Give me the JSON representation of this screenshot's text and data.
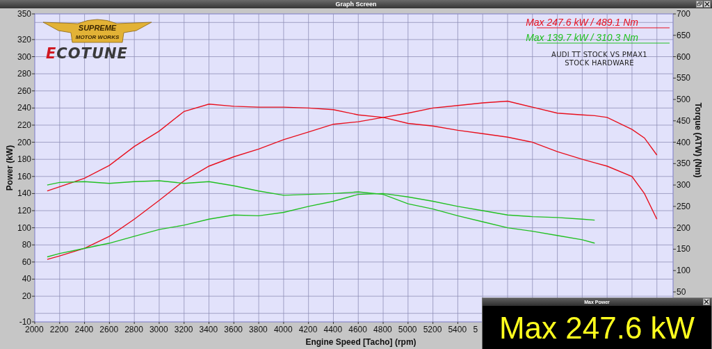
{
  "window": {
    "title": "Graph Screen"
  },
  "logos": {
    "badge_lines": [
      "SUPREME",
      "MOTOR WORKS"
    ],
    "wordmark": "ECOTUNE"
  },
  "legend": [
    {
      "text": "Max 247.6 kW  / 489.1 Nm",
      "color": "#e8101e"
    },
    {
      "text": "Max 139.7 kW  / 310.3 Nm",
      "color": "#22c022"
    }
  ],
  "caption": [
    "AUDI TT STOCK VS PMAX1",
    "STOCK HARDWARE"
  ],
  "chart_data": {
    "type": "line",
    "xlabel": "Engine Speed [Tacho] (rpm)",
    "ylabel": "Power (kW)",
    "y2label": "Torque (ATW) (Nm)",
    "x": [
      2100,
      2200,
      2400,
      2600,
      2800,
      3000,
      3200,
      3400,
      3600,
      3800,
      4000,
      4200,
      4400,
      4600,
      4800,
      5000,
      5200,
      5400,
      5600,
      5800,
      6000,
      6200,
      6400,
      6500,
      6600,
      6800,
      6900,
      7000
    ],
    "xlim": [
      2000,
      7130
    ],
    "ylim": [
      -10,
      350
    ],
    "y2lim": [
      -20,
      700
    ],
    "xticks": [
      2000,
      2200,
      2400,
      2600,
      2800,
      3000,
      3200,
      3400,
      3600,
      3800,
      4000,
      4200,
      4400,
      4600,
      4800,
      5000,
      5200,
      5400
    ],
    "grid": true,
    "yticks": [
      350,
      320,
      300,
      280,
      260,
      240,
      220,
      200,
      180,
      160,
      140,
      120,
      100,
      80,
      60,
      40,
      20,
      -10
    ],
    "y2ticks": [
      700,
      650,
      600,
      550,
      500,
      450,
      400,
      350,
      300,
      250,
      200,
      150,
      100,
      50
    ],
    "series": [
      {
        "color": "#e8101e",
        "values": [
          63,
          67,
          76,
          90,
          110,
          132,
          155,
          172,
          183,
          192,
          203,
          212,
          221,
          224,
          229,
          234,
          240,
          243,
          246,
          248,
          241,
          234,
          232,
          231,
          229,
          215,
          205,
          185
        ]
      },
      {
        "color": "#e8101e",
        "axis": "y2",
        "values": [
          286,
          296,
          316,
          346,
          390,
          426,
          472,
          489,
          484,
          482,
          482,
          480,
          476,
          464,
          458,
          444,
          438,
          428,
          420,
          412,
          400,
          378,
          360,
          352,
          344,
          320,
          280,
          220
        ]
      },
      {
        "color": "#22c022",
        "values": [
          66,
          70,
          76,
          82,
          90,
          98,
          103,
          110,
          115,
          114,
          118,
          125,
          131,
          139,
          140,
          136,
          131,
          125,
          120,
          115,
          113,
          112,
          110,
          109,
          null,
          null,
          null,
          null
        ]
      },
      {
        "color": "#22c022",
        "axis": "y2",
        "values": [
          300,
          306,
          308,
          304,
          308,
          310,
          304,
          308,
          298,
          286,
          276,
          278,
          280,
          284,
          278,
          256,
          244,
          228,
          214,
          200,
          192,
          182,
          172,
          164,
          null,
          null,
          null,
          null
        ]
      }
    ]
  },
  "popup": {
    "title": "Max Power",
    "value": "Max 247.6 kW"
  },
  "x_axis_cut_label": "5"
}
